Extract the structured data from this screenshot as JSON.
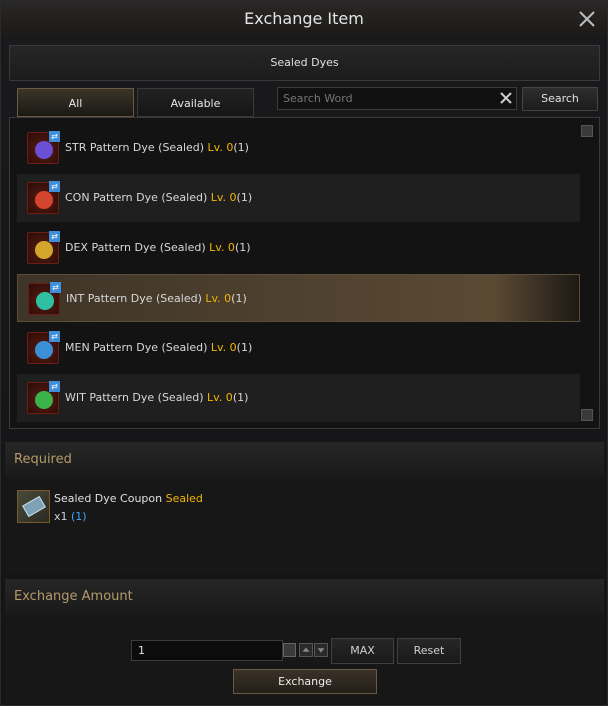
{
  "window": {
    "title": "Exchange Item"
  },
  "category": {
    "label": "Sealed Dyes"
  },
  "tabs": [
    {
      "label": "All",
      "active": true
    },
    {
      "label": "Available",
      "active": false
    }
  ],
  "search": {
    "placeholder": "Search Word",
    "button_label": "Search"
  },
  "items": [
    {
      "name": "STR Pattern Dye (Sealed)",
      "level": "Lv. 0",
      "count": "(1)",
      "color": "#6b4fd6"
    },
    {
      "name": "CON Pattern Dye (Sealed)",
      "level": "Lv. 0",
      "count": "(1)",
      "color": "#d4452f"
    },
    {
      "name": "DEX Pattern Dye (Sealed)",
      "level": "Lv. 0",
      "count": "(1)",
      "color": "#d4a72c"
    },
    {
      "name": "INT Pattern Dye (Sealed)",
      "level": "Lv. 0",
      "count": "(1)",
      "color": "#2fbfa2"
    },
    {
      "name": "MEN Pattern Dye (Sealed)",
      "level": "Lv. 0",
      "count": "(1)",
      "color": "#3a8fd6"
    },
    {
      "name": "WIT Pattern Dye (Sealed)",
      "level": "Lv. 0",
      "count": "(1)",
      "color": "#3bb34a"
    }
  ],
  "required": {
    "heading": "Required",
    "item_name": "Sealed Dye Coupon",
    "item_tag": "Sealed",
    "quantity": "x1",
    "owned": "(1)"
  },
  "amount": {
    "heading": "Exchange Amount",
    "value": "1",
    "max_label": "MAX",
    "reset_label": "Reset",
    "exchange_label": "Exchange"
  }
}
